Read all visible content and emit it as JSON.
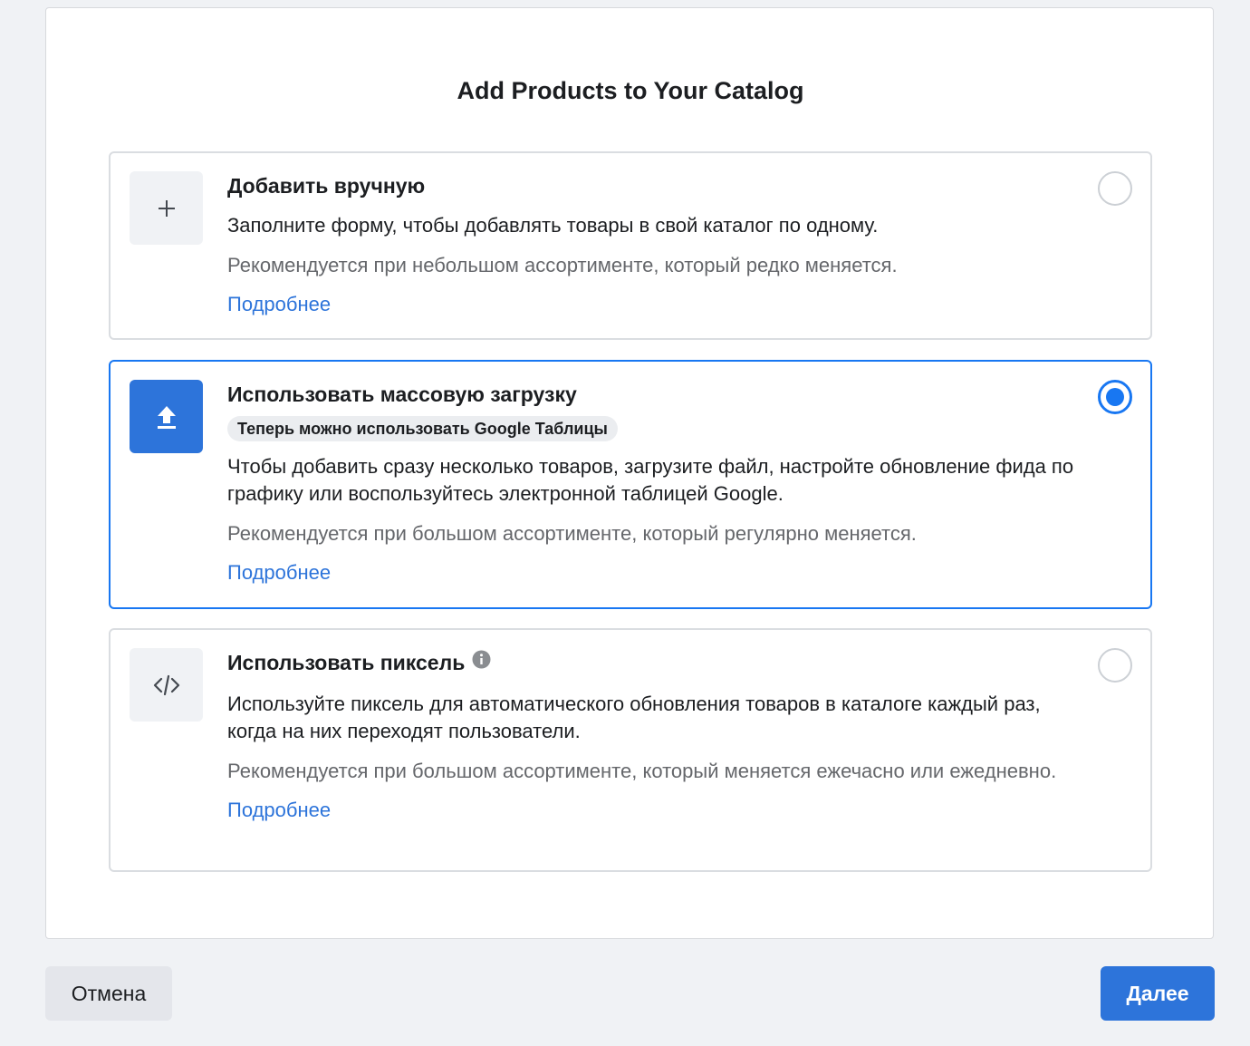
{
  "dialog": {
    "title": "Add Products to Your Catalog"
  },
  "options": [
    {
      "icon": "plus-icon",
      "title": "Добавить вручную",
      "description": "Заполните форму, чтобы добавлять товары в свой каталог по одному.",
      "recommendation": "Рекомендуется при небольшом ассортименте, который редко меняется.",
      "link": "Подробнее",
      "selected": false
    },
    {
      "icon": "upload-icon",
      "title": "Использовать массовую загрузку",
      "badge": "Теперь можно использовать Google Таблицы",
      "description": "Чтобы добавить сразу несколько товаров, загрузите файл, настройте обновление фида по графику или воспользуйтесь электронной таблицей Google.",
      "recommendation": "Рекомендуется при большом ассортименте, который регулярно меняется.",
      "link": "Подробнее",
      "selected": true
    },
    {
      "icon": "code-icon",
      "title": "Использовать пиксель",
      "description": "Используйте пиксель для автоматического обновления товаров в каталоге каждый раз, когда на них переходят пользователи.",
      "recommendation": "Рекомендуется при большом ассортименте, который меняется ежечасно или ежедневно.",
      "link": "Подробнее",
      "selected": false
    }
  ],
  "footer": {
    "cancel_label": "Отмена",
    "next_label": "Далее"
  },
  "colors": {
    "accent": "#1877f2",
    "link": "#2d74da",
    "muted_text": "#65676b"
  }
}
